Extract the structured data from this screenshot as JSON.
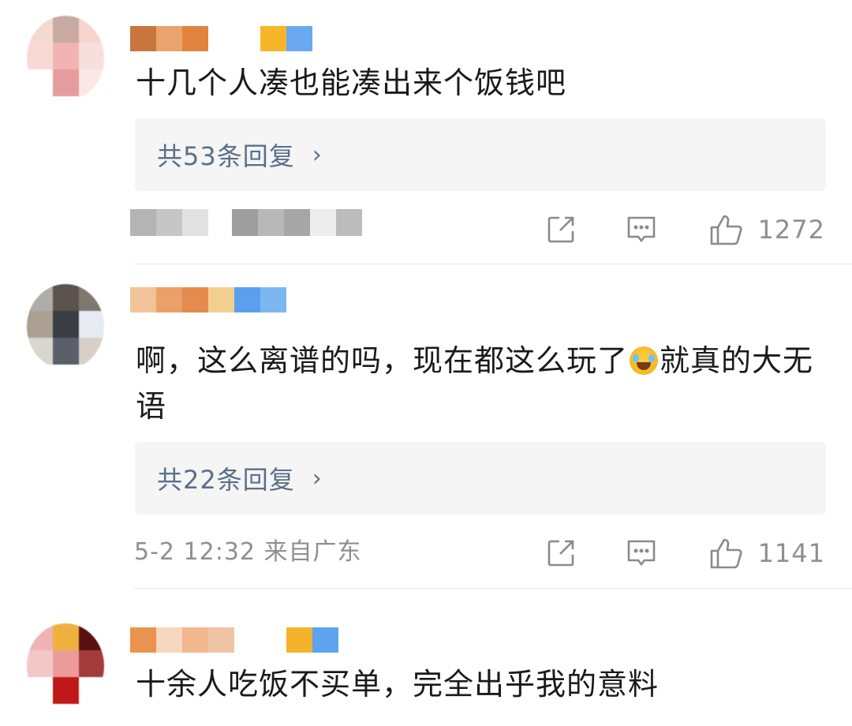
{
  "comments": [
    {
      "text": "十几个人凑也能凑出来个饭钱吧",
      "replies_label": "共53条回复",
      "replies_chevron": "›",
      "meta": "",
      "likes": "1272",
      "avatar_colors": [
        "#f4d9cf",
        "#c8aaa0",
        "#f6d3cc",
        "#f8d9d3",
        "#f2b4b3",
        "#f7e0dc",
        "#ffffff",
        "#e69c9c",
        "#fbe8e6"
      ],
      "nick_colors": [
        "#c8763e",
        "#eaa36c",
        "#e0843e",
        "#ffffff",
        "#ffffff",
        "#f7b62a",
        "#6aa8ef"
      ]
    },
    {
      "text_before_emoji": "啊，这么离谱的吗，现在都这么玩了",
      "emoji": "laughing-crying-emoji",
      "text_after_emoji": "就真的大无语",
      "replies_label": "共22条回复",
      "replies_chevron": "›",
      "meta": "5-2 12:32 来自广东",
      "likes": "1141",
      "avatar_colors": [
        "#b0aca7",
        "#5b544e",
        "#7f7870",
        "#ab9f92",
        "#3b3d45",
        "#e6eaf2",
        "#d9d5cf",
        "#5b5f69",
        "#d8d0c6"
      ],
      "nick_colors": [
        "#f3c39a",
        "#eaa068",
        "#e38c4e",
        "#f3cf8f",
        "#5aa0ee",
        "#7cb7f0"
      ]
    },
    {
      "text": "十余人吃饭不买单，完全出乎我的意料",
      "avatar_colors": [
        "#efb3b3",
        "#f0b040",
        "#5a1010",
        "#f4c7c7",
        "#ec9b9b",
        "#a43a3a",
        "#ffffff",
        "#c01818",
        "#ffffff"
      ],
      "nick_colors": [
        "#e9934e",
        "#f6d7bf",
        "#f2b78f",
        "#efc4a4",
        "#ffffff",
        "#ffffff",
        "#f5b32c",
        "#5da3ee"
      ]
    }
  ],
  "colors": {
    "reply_link": "#5a6f8a",
    "meta_text": "#8f8f8f",
    "reply_bg": "#f5f5f5"
  }
}
